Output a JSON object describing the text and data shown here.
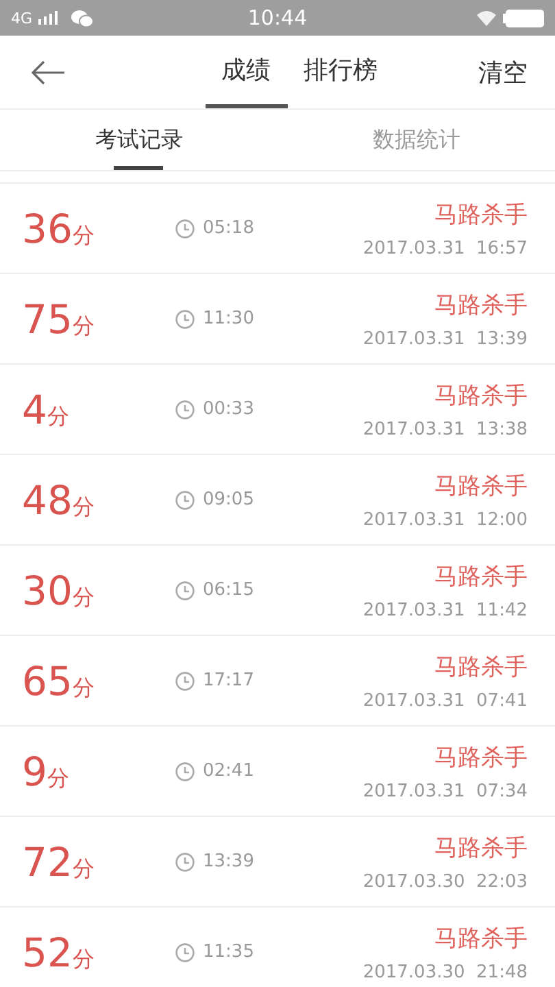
{
  "status_bar": {
    "network": "4G",
    "time": "10:44"
  },
  "header": {
    "tabs": [
      {
        "label": "成绩",
        "selected": true
      },
      {
        "label": "排行榜",
        "selected": false
      }
    ],
    "action": "清空"
  },
  "sub_tabs": [
    {
      "label": "考试记录",
      "selected": true
    },
    {
      "label": "数据统计",
      "selected": false
    }
  ],
  "records": [
    {
      "score": "36",
      "unit": "分",
      "duration": "05:18",
      "name": "马路杀手",
      "date": "2017.03.31  16:57"
    },
    {
      "score": "75",
      "unit": "分",
      "duration": "11:30",
      "name": "马路杀手",
      "date": "2017.03.31  13:39"
    },
    {
      "score": "4",
      "unit": "分",
      "duration": "00:33",
      "name": "马路杀手",
      "date": "2017.03.31  13:38"
    },
    {
      "score": "48",
      "unit": "分",
      "duration": "09:05",
      "name": "马路杀手",
      "date": "2017.03.31  12:00"
    },
    {
      "score": "30",
      "unit": "分",
      "duration": "06:15",
      "name": "马路杀手",
      "date": "2017.03.31  11:42"
    },
    {
      "score": "65",
      "unit": "分",
      "duration": "17:17",
      "name": "马路杀手",
      "date": "2017.03.31  07:41"
    },
    {
      "score": "9",
      "unit": "分",
      "duration": "02:41",
      "name": "马路杀手",
      "date": "2017.03.31  07:34"
    },
    {
      "score": "72",
      "unit": "分",
      "duration": "13:39",
      "name": "马路杀手",
      "date": "2017.03.30  22:03"
    },
    {
      "score": "52",
      "unit": "分",
      "duration": "11:35",
      "name": "马路杀手",
      "date": "2017.03.30  21:48"
    }
  ]
}
